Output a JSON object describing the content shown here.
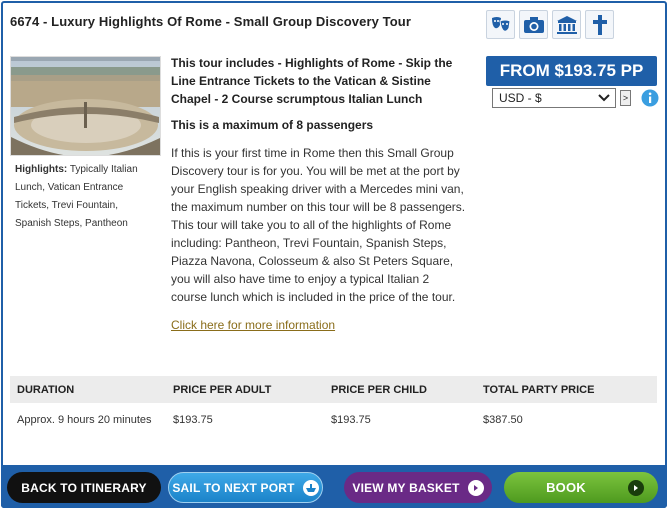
{
  "tour": {
    "title": "6674 - Luxury Highlights Of Rome - Small Group Discovery Tour",
    "includes": "This tour includes - Highlights of Rome - Skip the Line Entrance Tickets to the Vatican & Sistine Chapel - 2 Course scrumptous Italian Lunch",
    "max_passengers": "This is a maximum of 8 passengers",
    "description": "If this is your first time in Rome then this Small Group Discovery tour is for you.  You will be met at the port by your English speaking driver with a Mercedes mini van, the maximum number on this tour will be 8 passengers.  This tour will take you to all of the highlights of Rome including:  Pantheon, Trevi Fountain, Spanish Steps, Piazza Navona, Colosseum & also St Peters Square, you will also have time to enjoy a typical Italian 2 course lunch which is included in the price of the tour.",
    "more_info_link": "Click here for more information",
    "highlights_label": "Highlights:",
    "highlights_text": " Typically Italian Lunch, Vatican Entrance Tickets, Trevi Fountain, Spanish Steps, Pantheon"
  },
  "category_icons": [
    "theatre-masks-icon",
    "camera-icon",
    "museum-icon",
    "cross-icon"
  ],
  "price": {
    "badge": "FROM $193.75 PP",
    "currency_selected": "USD - $",
    "go_label": ">"
  },
  "table": {
    "headers": [
      "DURATION",
      "PRICE PER ADULT",
      "PRICE PER CHILD",
      "TOTAL PARTY PRICE"
    ],
    "row": [
      "Approx. 9 hours 20 minutes",
      "$193.75",
      "$193.75",
      "$387.50"
    ]
  },
  "footer": {
    "back": "BACK TO ITINERARY",
    "next": "SAIL TO NEXT PORT",
    "basket": "VIEW MY BASKET",
    "book": "BOOK"
  },
  "colors": {
    "brand_blue": "#1f5fa8",
    "basket_purple": "#6a2a86",
    "book_green": "#5aa829",
    "link_gold": "#8a6d1a"
  }
}
